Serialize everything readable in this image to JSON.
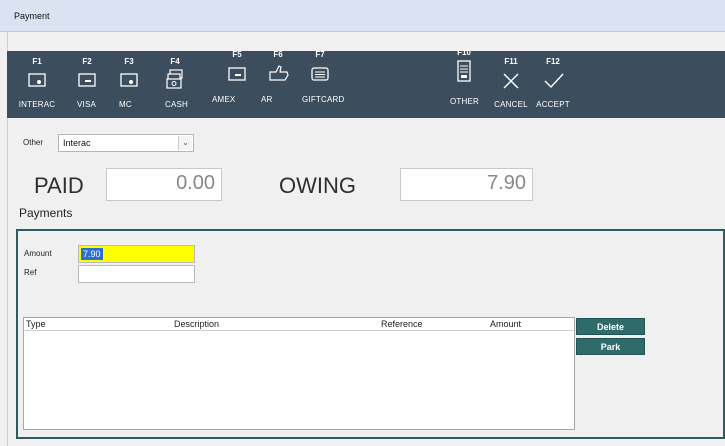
{
  "window": {
    "title": "Payment"
  },
  "toolbar": {
    "buttons": [
      {
        "key": "F1",
        "label": "INTERAC",
        "icon": "card-chip-icon"
      },
      {
        "key": "F2",
        "label": "VISA",
        "icon": "card-icon"
      },
      {
        "key": "F3",
        "label": "MC",
        "icon": "card-chip-icon"
      },
      {
        "key": "F4",
        "label": "CASH",
        "icon": "cash-icon"
      },
      {
        "key": "F5",
        "label": "AMEX",
        "icon": "card-icon"
      },
      {
        "key": "F6",
        "label": "AR",
        "icon": "hand-icon"
      },
      {
        "key": "F7",
        "label": "GIFTCARD",
        "icon": "giftcard-icon"
      },
      {
        "key": "F10",
        "label": "OTHER",
        "icon": "document-icon"
      },
      {
        "key": "F11",
        "label": "CANCEL",
        "icon": "x-icon"
      },
      {
        "key": "F12",
        "label": "ACCEPT",
        "icon": "check-icon"
      }
    ]
  },
  "other": {
    "label": "Other",
    "selected": "Interac"
  },
  "totals": {
    "paid_label": "PAID",
    "paid_value": "0.00",
    "owing_label": "OWING",
    "owing_value": "7.90"
  },
  "payments": {
    "title": "Payments",
    "amount_label": "Amount",
    "amount_value": "7.90",
    "ref_label": "Ref",
    "ref_value": "",
    "columns": [
      "Type",
      "Description",
      "Reference",
      "Amount"
    ],
    "rows": [],
    "delete_label": "Delete",
    "park_label": "Park"
  },
  "colors": {
    "toolbar_bg": "#3c4d5e",
    "action_button": "#2f6b6b",
    "amount_highlight": "#ffff00"
  }
}
